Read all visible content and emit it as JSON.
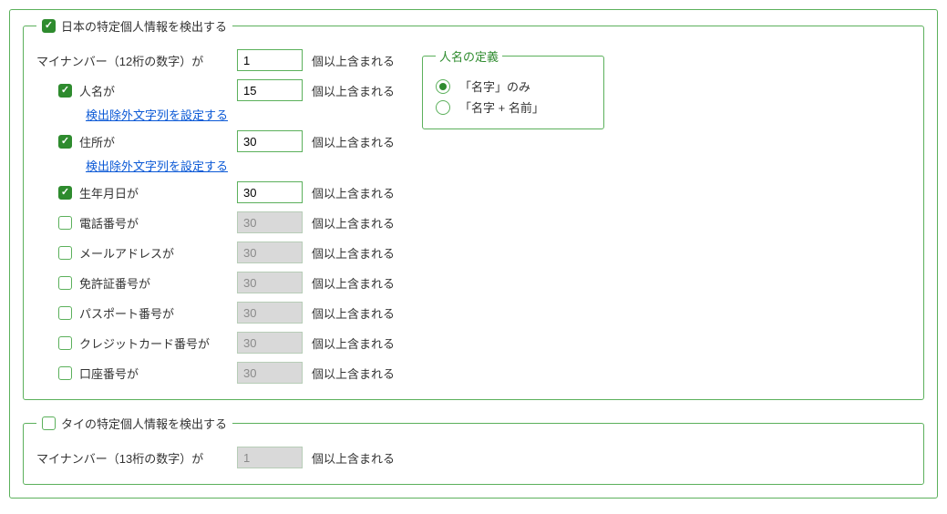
{
  "japan": {
    "title": "日本の特定個人情報を検出する",
    "checked": true,
    "mynumber": {
      "label": "マイナンバー（12桁の数字）が",
      "value": "1",
      "suffix": "個以上含まれる"
    },
    "items": [
      {
        "label": "人名が",
        "checked": true,
        "value": "15",
        "suffix": "個以上含まれる",
        "exclude": "検出除外文字列を設定する"
      },
      {
        "label": "住所が",
        "checked": true,
        "value": "30",
        "suffix": "個以上含まれる",
        "exclude": "検出除外文字列を設定する"
      },
      {
        "label": "生年月日が",
        "checked": true,
        "value": "30",
        "suffix": "個以上含まれる"
      },
      {
        "label": "電話番号が",
        "checked": false,
        "value": "30",
        "suffix": "個以上含まれる"
      },
      {
        "label": "メールアドレスが",
        "checked": false,
        "value": "30",
        "suffix": "個以上含まれる"
      },
      {
        "label": "免許証番号が",
        "checked": false,
        "value": "30",
        "suffix": "個以上含まれる"
      },
      {
        "label": "パスポート番号が",
        "checked": false,
        "value": "30",
        "suffix": "個以上含まれる"
      },
      {
        "label": "クレジットカード番号が",
        "checked": false,
        "value": "30",
        "suffix": "個以上含まれる"
      },
      {
        "label": "口座番号が",
        "checked": false,
        "value": "30",
        "suffix": "個以上含まれる"
      }
    ],
    "name_def": {
      "title": "人名の定義",
      "options": [
        "「名字」のみ",
        "「名字 + 名前」"
      ],
      "selected": 0
    }
  },
  "thai": {
    "title": "タイの特定個人情報を検出する",
    "checked": false,
    "mynumber": {
      "label": "マイナンバー（13桁の数字）が",
      "value": "1",
      "suffix": "個以上含まれる"
    }
  }
}
